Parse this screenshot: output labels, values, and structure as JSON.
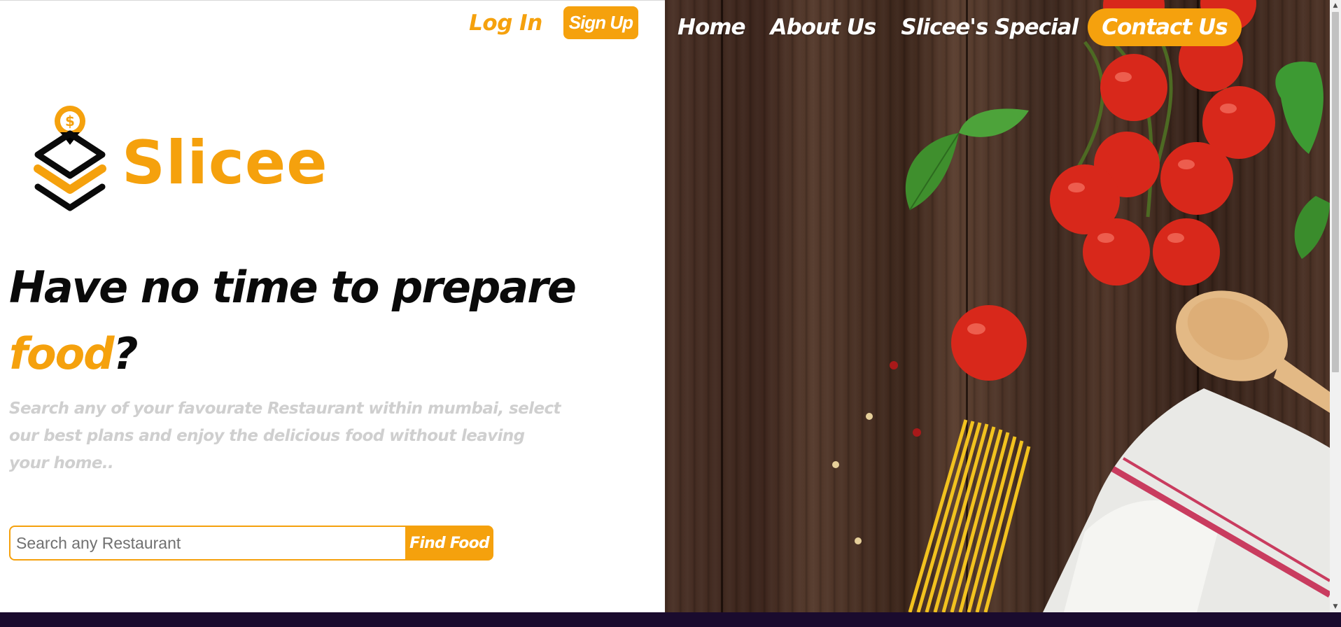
{
  "auth": {
    "login_label": "Log In",
    "signup_label": "Sign Up"
  },
  "brand": {
    "name": "Slicee",
    "accent_color": "#f5a10d",
    "icon": "dollar-pin-stacked-layers-icon"
  },
  "hero": {
    "headline_part1": "Have no time to prepare",
    "headline_accent": "food",
    "headline_end": "?",
    "subtext": "Search any of your favourate Restaurant within mumbai, select our best plans and enjoy the delicious food without leaving your home.."
  },
  "search": {
    "placeholder": "Search any Restaurant",
    "value": "",
    "button_label": "Find Food"
  },
  "nav": {
    "items": [
      {
        "label": "Home"
      },
      {
        "label": "About Us"
      },
      {
        "label": "Slicee's Special"
      }
    ],
    "contact_label": "Contact Us"
  },
  "hero_image": {
    "subject": "cooking-ingredients-icon"
  },
  "colors": {
    "accent": "#f5a10d",
    "footer": "#1a0b2e",
    "subtext": "#cfcfcf"
  }
}
